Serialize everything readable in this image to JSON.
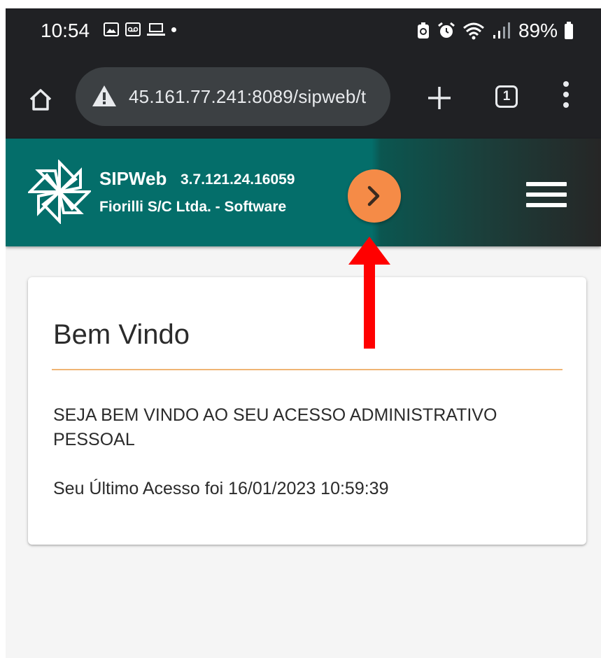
{
  "status_bar": {
    "time": "10:54",
    "battery_percent": "89%",
    "left_icons": [
      "image-icon",
      "voicemail-icon",
      "laptop-icon",
      "dot-icon"
    ],
    "right_icons": [
      "battery-saver-icon",
      "alarm-icon",
      "wifi-icon",
      "signal-icon",
      "battery-icon"
    ]
  },
  "browser": {
    "url": "45.161.77.241:8089/sipweb/t",
    "tab_count": "1",
    "security_icon": "warning-icon"
  },
  "app_header": {
    "name": "SIPWeb",
    "version": "3.7.121.24.16059",
    "company": "Fiorilli S/C Ltda. - Software",
    "accent_color": "#046e6a",
    "toggle_color": "#f58b47"
  },
  "card": {
    "title": "Bem Vindo",
    "message": "SEJA BEM VINDO AO SEU ACESSO ADMINISTRATIVO PESSOAL",
    "last_access": "Seu Último Acesso foi 16/01/2023 10:59:39",
    "divider_color": "#f0b574"
  },
  "annotation": {
    "arrow_color": "#ff0000"
  }
}
